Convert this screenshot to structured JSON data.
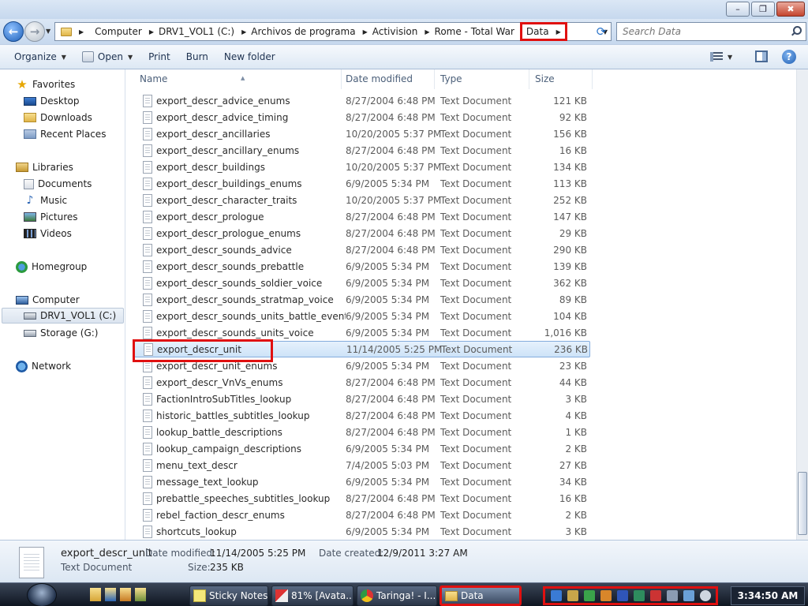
{
  "window": {
    "minimize_glyph": "–",
    "maximize_glyph": "❐",
    "close_glyph": "✖"
  },
  "address": {
    "crumbs": [
      "Computer",
      "DRV1_VOL1 (C:)",
      "Archivos de programa",
      "Activision",
      "Rome - Total War"
    ],
    "current": "Data",
    "search_placeholder": "Search Data"
  },
  "toolbar": {
    "organize": "Organize",
    "open": "Open",
    "print": "Print",
    "burn": "Burn",
    "new_folder": "New folder",
    "help": "?"
  },
  "nav": {
    "favorites": "Favorites",
    "desktop": "Desktop",
    "downloads": "Downloads",
    "recent_places": "Recent Places",
    "libraries": "Libraries",
    "documents": "Documents",
    "music": "Music",
    "pictures": "Pictures",
    "videos": "Videos",
    "homegroup": "Homegroup",
    "computer": "Computer",
    "drive_c": "DRV1_VOL1 (C:)",
    "drive_g": "Storage (G:)",
    "network": "Network"
  },
  "columns": {
    "name": "Name",
    "date": "Date modified",
    "type": "Type",
    "size": "Size"
  },
  "files": [
    {
      "name": "export_descr_advice_enums",
      "date": "8/27/2004 6:48 PM",
      "type": "Text Document",
      "size": "121 KB"
    },
    {
      "name": "export_descr_advice_timing",
      "date": "8/27/2004 6:48 PM",
      "type": "Text Document",
      "size": "92 KB"
    },
    {
      "name": "export_descr_ancillaries",
      "date": "10/20/2005 5:37 PM",
      "type": "Text Document",
      "size": "156 KB"
    },
    {
      "name": "export_descr_ancillary_enums",
      "date": "8/27/2004 6:48 PM",
      "type": "Text Document",
      "size": "16 KB"
    },
    {
      "name": "export_descr_buildings",
      "date": "10/20/2005 5:37 PM",
      "type": "Text Document",
      "size": "134 KB"
    },
    {
      "name": "export_descr_buildings_enums",
      "date": "6/9/2005 5:34 PM",
      "type": "Text Document",
      "size": "113 KB"
    },
    {
      "name": "export_descr_character_traits",
      "date": "10/20/2005 5:37 PM",
      "type": "Text Document",
      "size": "252 KB"
    },
    {
      "name": "export_descr_prologue",
      "date": "8/27/2004 6:48 PM",
      "type": "Text Document",
      "size": "147 KB"
    },
    {
      "name": "export_descr_prologue_enums",
      "date": "8/27/2004 6:48 PM",
      "type": "Text Document",
      "size": "29 KB"
    },
    {
      "name": "export_descr_sounds_advice",
      "date": "8/27/2004 6:48 PM",
      "type": "Text Document",
      "size": "290 KB"
    },
    {
      "name": "export_descr_sounds_prebattle",
      "date": "6/9/2005 5:34 PM",
      "type": "Text Document",
      "size": "139 KB"
    },
    {
      "name": "export_descr_sounds_soldier_voice",
      "date": "6/9/2005 5:34 PM",
      "type": "Text Document",
      "size": "362 KB"
    },
    {
      "name": "export_descr_sounds_stratmap_voice",
      "date": "6/9/2005 5:34 PM",
      "type": "Text Document",
      "size": "89 KB"
    },
    {
      "name": "export_descr_sounds_units_battle_events",
      "date": "6/9/2005 5:34 PM",
      "type": "Text Document",
      "size": "104 KB"
    },
    {
      "name": "export_descr_sounds_units_voice",
      "date": "6/9/2005 5:34 PM",
      "type": "Text Document",
      "size": "1,016 KB"
    },
    {
      "name": "export_descr_unit",
      "date": "11/14/2005 5:25 PM",
      "type": "Text Document",
      "size": "236 KB",
      "selected": true
    },
    {
      "name": "export_descr_unit_enums",
      "date": "6/9/2005 5:34 PM",
      "type": "Text Document",
      "size": "23 KB"
    },
    {
      "name": "export_descr_VnVs_enums",
      "date": "8/27/2004 6:48 PM",
      "type": "Text Document",
      "size": "44 KB"
    },
    {
      "name": "FactionIntroSubTitles_lookup",
      "date": "8/27/2004 6:48 PM",
      "type": "Text Document",
      "size": "3 KB"
    },
    {
      "name": "historic_battles_subtitles_lookup",
      "date": "8/27/2004 6:48 PM",
      "type": "Text Document",
      "size": "4 KB"
    },
    {
      "name": "lookup_battle_descriptions",
      "date": "8/27/2004 6:48 PM",
      "type": "Text Document",
      "size": "1 KB"
    },
    {
      "name": "lookup_campaign_descriptions",
      "date": "6/9/2005 5:34 PM",
      "type": "Text Document",
      "size": "2 KB"
    },
    {
      "name": "menu_text_descr",
      "date": "7/4/2005 5:03 PM",
      "type": "Text Document",
      "size": "27 KB"
    },
    {
      "name": "message_text_lookup",
      "date": "6/9/2005 5:34 PM",
      "type": "Text Document",
      "size": "34 KB"
    },
    {
      "name": "prebattle_speeches_subtitles_lookup",
      "date": "8/27/2004 6:48 PM",
      "type": "Text Document",
      "size": "16 KB"
    },
    {
      "name": "rebel_faction_descr_enums",
      "date": "8/27/2004 6:48 PM",
      "type": "Text Document",
      "size": "2 KB"
    },
    {
      "name": "shortcuts_lookup",
      "date": "6/9/2005 5:34 PM",
      "type": "Text Document",
      "size": "3 KB"
    }
  ],
  "details": {
    "name": "export_descr_unit",
    "type": "Text Document",
    "date_modified_label": "Date modified:",
    "date_modified": "11/14/2005 5:25 PM",
    "size_label": "Size:",
    "size": "235 KB",
    "date_created_label": "Date created:",
    "date_created": "12/9/2011 3:27 AM"
  },
  "taskbar": {
    "buttons": [
      "Sticky Notes",
      "81% [Avata...",
      "Taringa! - I...",
      "Data"
    ],
    "clock": "3:34:50 AM"
  },
  "colors": {
    "highlight_red": "#e01010",
    "selection_blue": "#cde3f8"
  }
}
